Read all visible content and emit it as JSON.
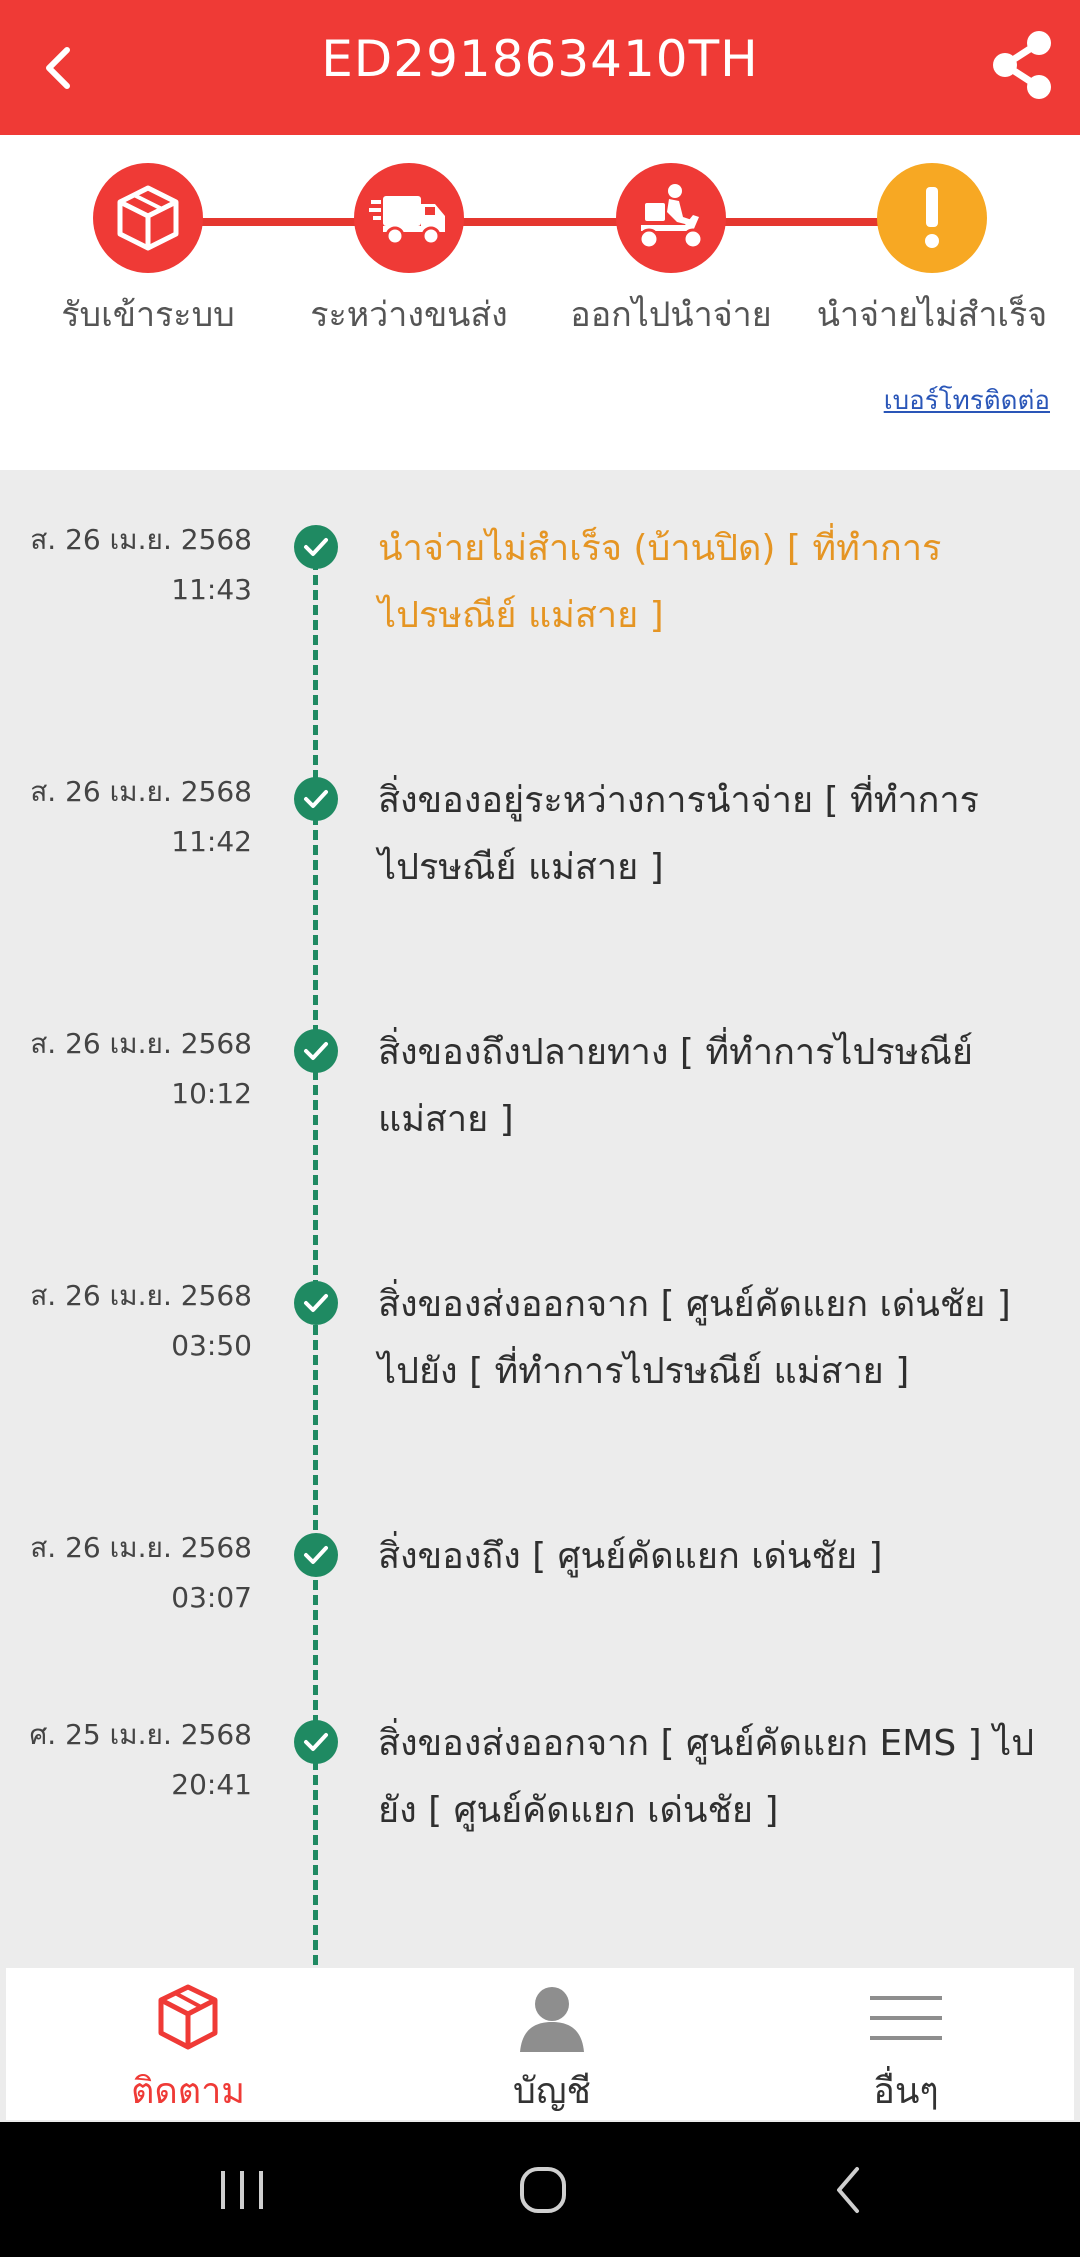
{
  "header": {
    "title": "ED291863410TH"
  },
  "steps": [
    {
      "label": "รับเข้าระบบ",
      "icon": "box-icon",
      "status": "done"
    },
    {
      "label": "ระหว่างขนส่ง",
      "icon": "truck-icon",
      "status": "done"
    },
    {
      "label": "ออกไปนำจ่าย",
      "icon": "delivery-scooter-icon",
      "status": "done"
    },
    {
      "label": "นำจ่ายไม่สำเร็จ",
      "icon": "exclamation-icon",
      "status": "warning"
    }
  ],
  "contact_link": "เบอร์โทรติดต่อ",
  "events": [
    {
      "date": "ส. 26 เม.ย. 2568",
      "time": "11:43",
      "text": "นำจ่ายไม่สำเร็จ (บ้านปิด) [ ที่ทำการไปรษณีย์ แม่สาย ]",
      "highlight": true
    },
    {
      "date": "ส. 26 เม.ย. 2568",
      "time": "11:42",
      "text": "สิ่งของอยู่ระหว่างการนำจ่าย [ ที่ทำการไปรษณีย์ แม่สาย ]",
      "highlight": false
    },
    {
      "date": "ส. 26 เม.ย. 2568",
      "time": "10:12",
      "text": "สิ่งของถึงปลายทาง [ ที่ทำการไปรษณีย์ แม่สาย ]",
      "highlight": false
    },
    {
      "date": "ส. 26 เม.ย. 2568",
      "time": "03:50",
      "text": "สิ่งของส่งออกจาก [ ศูนย์คัดแยก เด่นชัย ] ไปยัง [ ที่ทำการไปรษณีย์ แม่สาย ]",
      "highlight": false
    },
    {
      "date": "ส. 26 เม.ย. 2568",
      "time": "03:07",
      "text": "สิ่งของถึง [ ศูนย์คัดแยก เด่นชัย ]",
      "highlight": false
    },
    {
      "date": "ศ. 25 เม.ย. 2568",
      "time": "20:41",
      "text": "สิ่งของส่งออกจาก [ ศูนย์คัดแยก EMS ] ไปยัง [ ศูนย์คัดแยก เด่นชัย ]",
      "highlight": false
    }
  ],
  "nav": [
    {
      "label": "ติดตาม",
      "icon": "package-icon",
      "active": true
    },
    {
      "label": "บัญชี",
      "icon": "user-icon",
      "active": false
    },
    {
      "label": "อื่นๆ",
      "icon": "menu-icon",
      "active": false
    }
  ],
  "colors": {
    "brand_red": "#ef3a36",
    "warning_orange": "#f7a823",
    "timeline_green": "#1f8a62",
    "link_blue": "#2a56b8"
  }
}
